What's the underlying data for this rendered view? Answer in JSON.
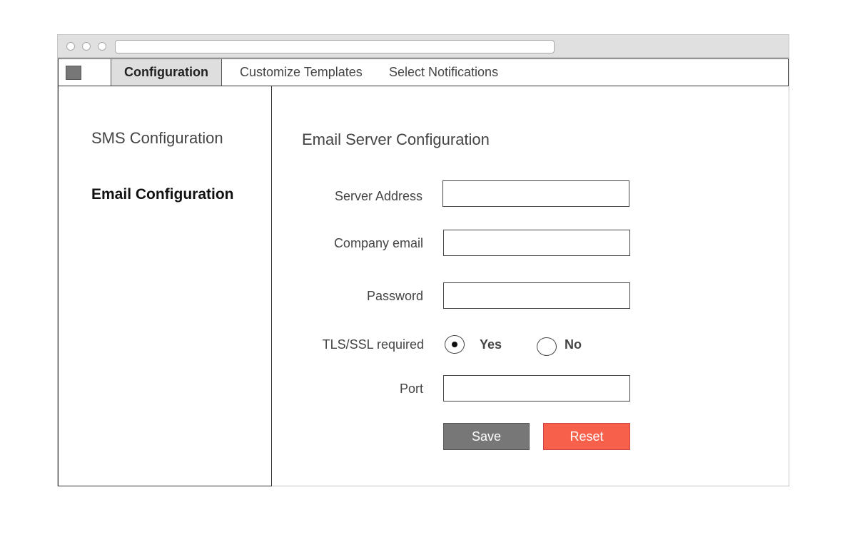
{
  "window": {
    "tabs": [
      {
        "label": "Configuration",
        "active": true
      },
      {
        "label": "Customize Templates",
        "active": false
      },
      {
        "label": "Select Notifications",
        "active": false
      }
    ]
  },
  "sidebar": {
    "items": [
      {
        "label": "SMS Configuration",
        "active": false
      },
      {
        "label": "Email Configuration",
        "active": true
      }
    ]
  },
  "main": {
    "title": "Email Server Configuration",
    "fields": {
      "server_address": {
        "label": "Server Address",
        "value": ""
      },
      "company_email": {
        "label": "Company email",
        "value": ""
      },
      "password": {
        "label": "Password",
        "value": ""
      },
      "tls_ssl": {
        "label": "TLS/SSL required",
        "options": [
          "Yes",
          "No"
        ],
        "selected": "Yes"
      },
      "port": {
        "label": "Port",
        "value": ""
      }
    },
    "buttons": {
      "save": "Save",
      "reset": "Reset"
    }
  },
  "colors": {
    "save_button": "#777777",
    "reset_button": "#f7604a",
    "active_tab": "#dedede"
  }
}
